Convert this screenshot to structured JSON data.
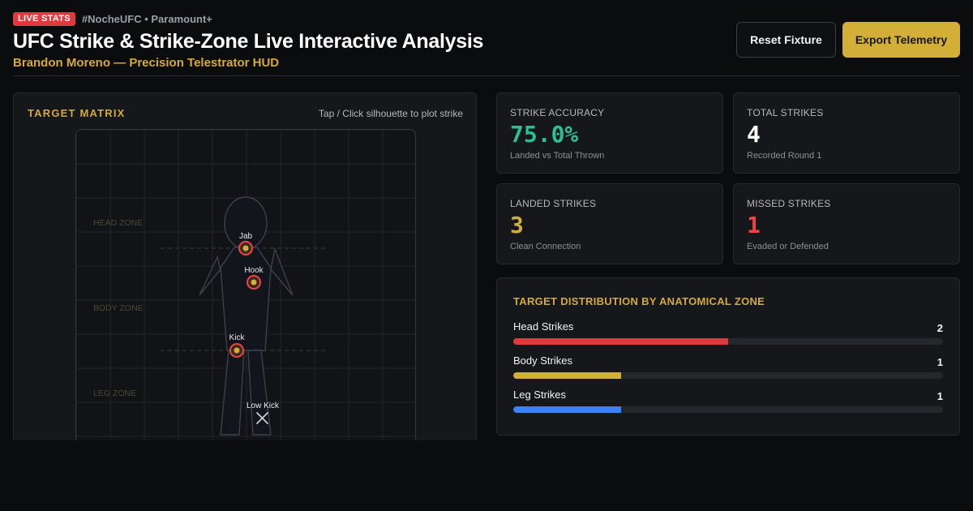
{
  "header": {
    "badge": "LIVE STATS",
    "hashtag": "#NocheUFC • Paramount+",
    "title": "UFC Strike & Strike-Zone Live Interactive Analysis",
    "subtitle": "Brandon Moreno — Precision Telestrator HUD",
    "reset_label": "Reset Fixture",
    "export_label": "Export Telemetry"
  },
  "matrix": {
    "title": "TARGET MATRIX",
    "hint": "Tap / Click silhouette to plot strike",
    "zones": [
      "HEAD ZONE",
      "BODY ZONE",
      "LEG ZONE"
    ],
    "strikes": [
      {
        "label": "Jab",
        "result": "landed"
      },
      {
        "label": "Hook",
        "result": "landed"
      },
      {
        "label": "Kick",
        "result": "landed"
      },
      {
        "label": "Low Kick",
        "result": "missed"
      }
    ]
  },
  "stats": {
    "accuracy": {
      "label": "STRIKE ACCURACY",
      "value": "75.0%",
      "note": "Landed vs Total Thrown"
    },
    "total": {
      "label": "TOTAL STRIKES",
      "value": "4",
      "note": "Recorded Round 1"
    },
    "landed": {
      "label": "LANDED STRIKES",
      "value": "3",
      "note": "Clean Connection"
    },
    "missed": {
      "label": "MISSED STRIKES",
      "value": "1",
      "note": "Evaded or Defended"
    }
  },
  "distribution": {
    "title": "TARGET DISTRIBUTION BY ANATOMICAL ZONE",
    "max": 4,
    "rows": [
      {
        "label": "Head Strikes",
        "count": "2",
        "value": 2,
        "color": "#e03a3e"
      },
      {
        "label": "Body Strikes",
        "count": "1",
        "value": 1,
        "color": "#d4af37"
      },
      {
        "label": "Leg Strikes",
        "count": "1",
        "value": 1,
        "color": "#3b82f6"
      }
    ]
  },
  "colors": {
    "accent": "#d4af37",
    "accuracy": "#2fbf8f",
    "landed": "#d4af37",
    "missed": "#ef4444",
    "live": "#e03a3e"
  }
}
